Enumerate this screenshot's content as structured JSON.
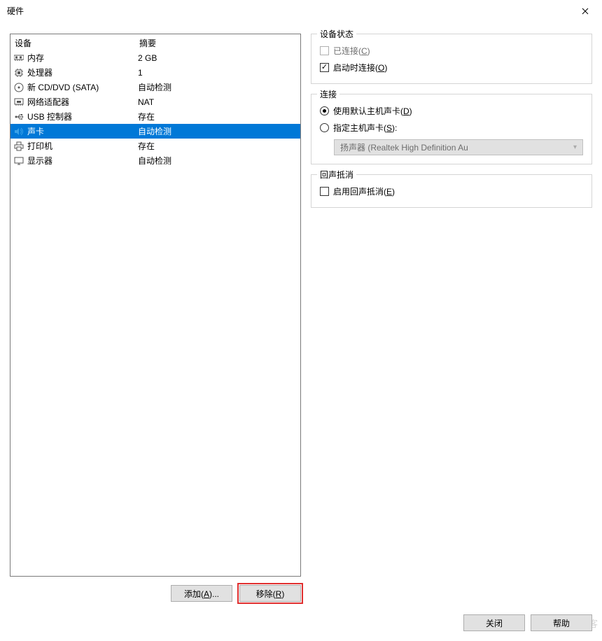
{
  "title": "硬件",
  "columns": {
    "device": "设备",
    "summary": "摘要"
  },
  "devices": [
    {
      "icon": "memory",
      "name": "内存",
      "summary": "2 GB"
    },
    {
      "icon": "cpu",
      "name": "处理器",
      "summary": "1"
    },
    {
      "icon": "disc",
      "name": "新 CD/DVD (SATA)",
      "summary": "自动检测"
    },
    {
      "icon": "nic",
      "name": "网络适配器",
      "summary": "NAT"
    },
    {
      "icon": "usb",
      "name": "USB 控制器",
      "summary": "存在"
    },
    {
      "icon": "sound",
      "name": "声卡",
      "summary": "自动检测"
    },
    {
      "icon": "printer",
      "name": "打印机",
      "summary": "存在"
    },
    {
      "icon": "display",
      "name": "显示器",
      "summary": "自动检测"
    }
  ],
  "selected_index": 5,
  "leftButtons": {
    "add": "添加(A)...",
    "remove": "移除(R)"
  },
  "status": {
    "legend": "设备状态",
    "connected": "已连接(C)",
    "connectOnStart": "启动时连接(O)"
  },
  "connection": {
    "legend": "连接",
    "useDefault": "使用默认主机声卡(D)",
    "specify": "指定主机声卡(S):",
    "selectValue": "扬声器 (Realtek High Definition Au"
  },
  "echo": {
    "legend": "回声抵消",
    "enable": "启用回声抵消(E)"
  },
  "footer": {
    "close": "关闭",
    "help": "帮助"
  },
  "watermark": "@51CTO博客"
}
